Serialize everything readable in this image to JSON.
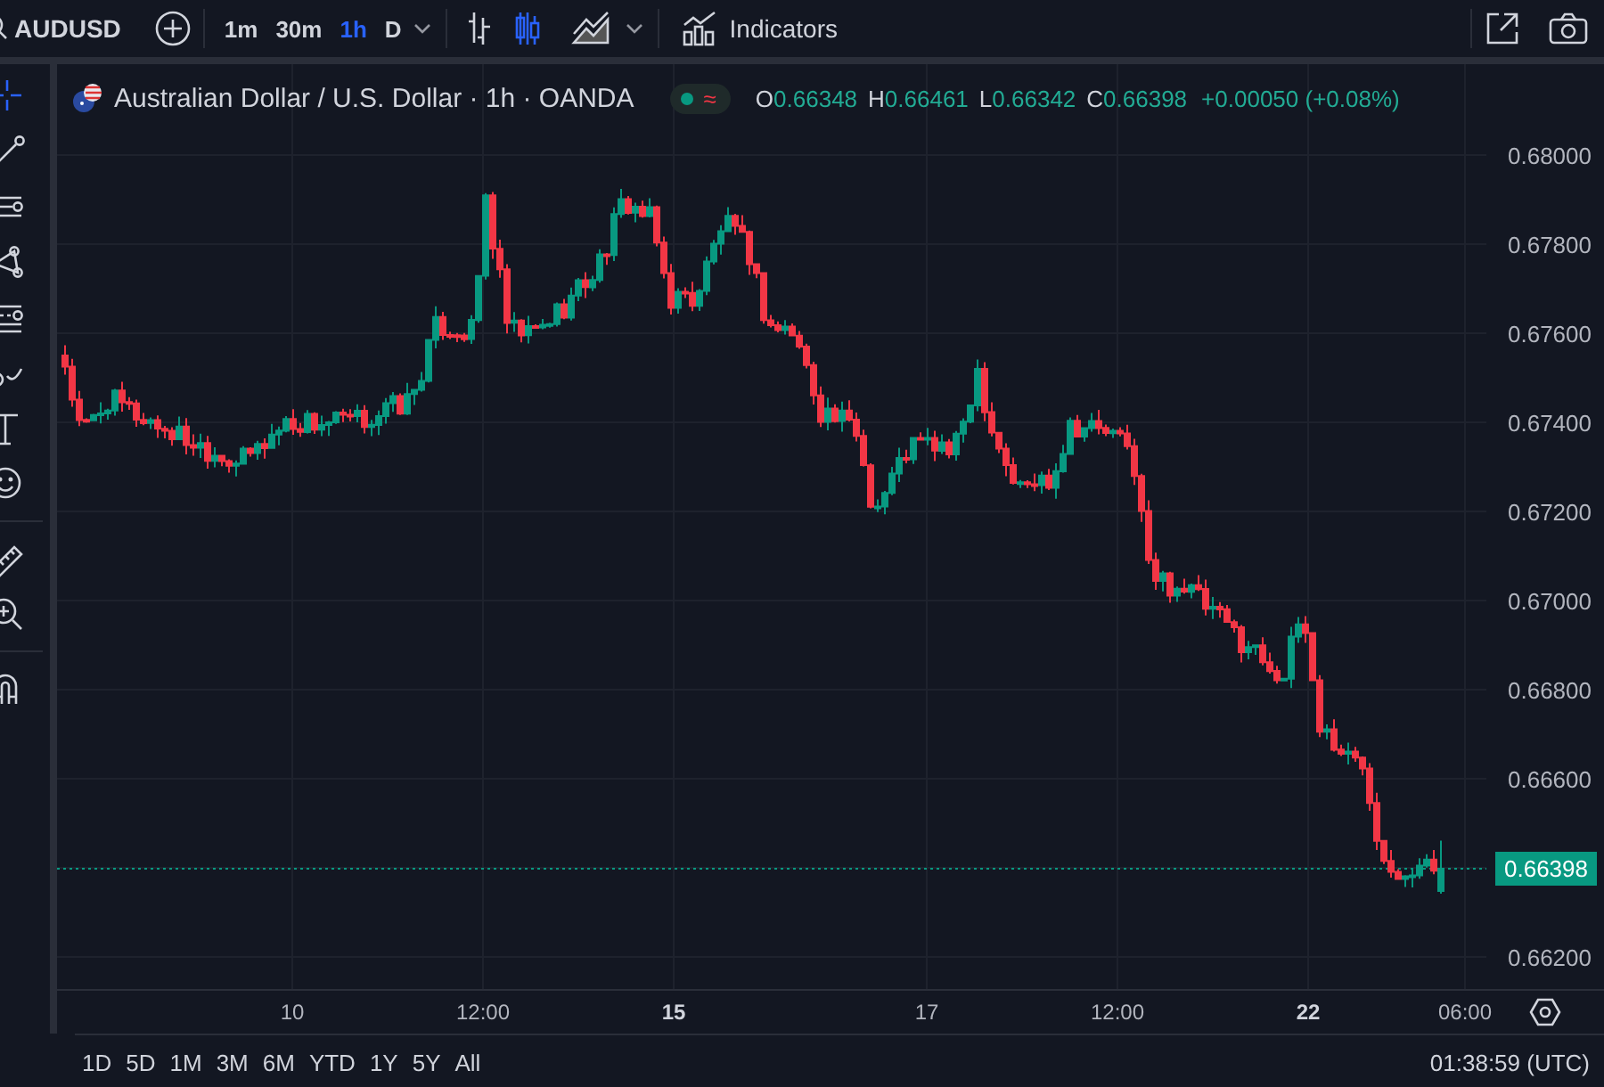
{
  "toolbar": {
    "symbol": "AUDUSD",
    "intervals": [
      {
        "label": "1m",
        "selected": false
      },
      {
        "label": "30m",
        "selected": false
      },
      {
        "label": "1h",
        "selected": true
      },
      {
        "label": "D",
        "selected": false
      }
    ],
    "chart_styles": [
      {
        "kind": "bars",
        "selected": false
      },
      {
        "kind": "candles",
        "selected": true
      },
      {
        "kind": "area",
        "selected": false
      }
    ],
    "indicators_label": "Indicators"
  },
  "legend": {
    "title": "Australian Dollar / U.S. Dollar · 1h · OANDA",
    "status_symbol": "≈",
    "ohlc": [
      {
        "key": "O",
        "value": "0.66348"
      },
      {
        "key": "H",
        "value": "0.66461"
      },
      {
        "key": "L",
        "value": "0.66342"
      },
      {
        "key": "C",
        "value": "0.66398"
      }
    ],
    "change": "+0.00050 (+0.08%)"
  },
  "price_axis": [
    {
      "kind": "tick",
      "label": "0.68000"
    },
    {
      "kind": "tick",
      "label": "0.67800"
    },
    {
      "kind": "tick",
      "label": "0.67600"
    },
    {
      "kind": "tick",
      "label": "0.67400"
    },
    {
      "kind": "tick",
      "label": "0.67200"
    },
    {
      "kind": "tick",
      "label": "0.67000"
    },
    {
      "kind": "tick",
      "label": "0.66800"
    },
    {
      "kind": "tick",
      "label": "0.66600"
    },
    {
      "kind": "current",
      "label": "0.66398"
    },
    {
      "kind": "tick",
      "label": "0.66200"
    }
  ],
  "time_axis": [
    {
      "label": "10",
      "major": false
    },
    {
      "label": "12:00",
      "major": false
    },
    {
      "label": "15",
      "major": true
    },
    {
      "label": "17",
      "major": false
    },
    {
      "label": "12:00",
      "major": false
    },
    {
      "label": "22",
      "major": true
    },
    {
      "label": "06:00",
      "major": false
    }
  ],
  "ranges": [
    "1D",
    "5D",
    "1M",
    "3M",
    "6M",
    "YTD",
    "1Y",
    "5Y",
    "All"
  ],
  "clock": "01:38:59 (UTC)"
}
